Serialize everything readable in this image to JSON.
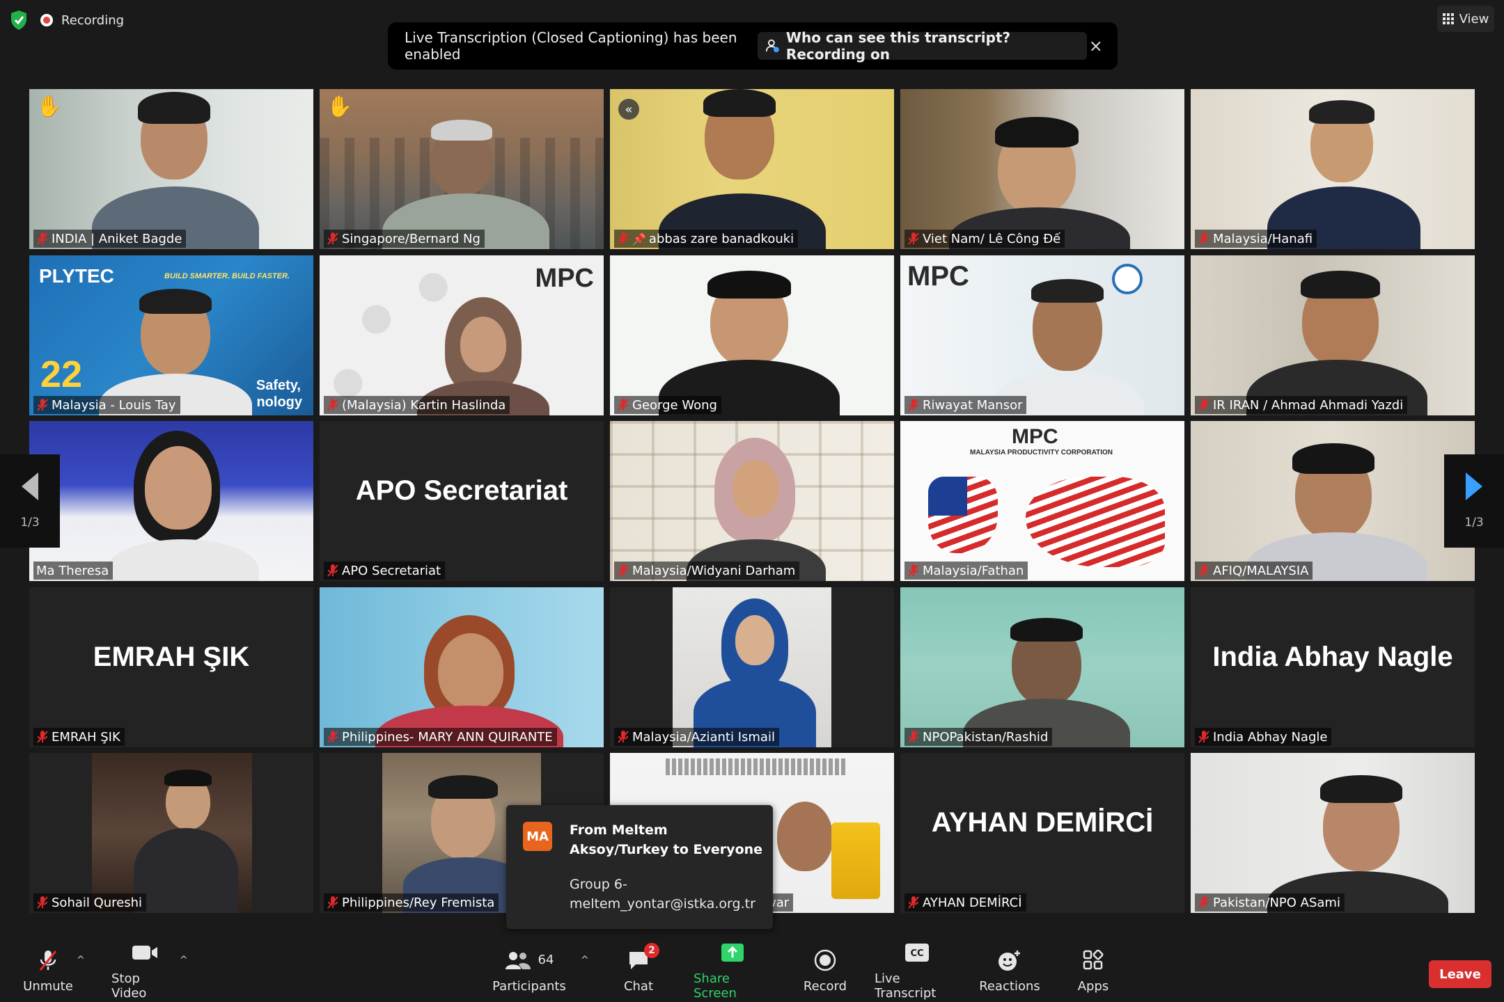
{
  "top": {
    "recording_label": "Recording",
    "view_label": "View"
  },
  "banner": {
    "text": "Live Transcription (Closed Captioning) has been enabled",
    "who_label": "Who can see this transcript? Recording on",
    "close": "×"
  },
  "participants": [
    {
      "name": "INDIA | Aniket Bagde"
    },
    {
      "name": "Singapore/Bernard Ng"
    },
    {
      "name": "abbas zare banadkouki"
    },
    {
      "name": "Viet Nam/ Lê Công Đế"
    },
    {
      "name": "Malaysia/Hanafi"
    },
    {
      "name": "Malaysia - Louis Tay"
    },
    {
      "name": "(Malaysia) Kartin Haslinda"
    },
    {
      "name": "George Wong"
    },
    {
      "name": "Riwayat Mansor"
    },
    {
      "name": "IR IRAN / Ahmad Ahmadi Yazdi"
    },
    {
      "name": "Ma Theresa"
    },
    {
      "name": "APO Secretariat"
    },
    {
      "name": "Malaysia/Widyani Darham"
    },
    {
      "name": "Malaysia/Fathan"
    },
    {
      "name": "AFIQ/MALAYSIA"
    },
    {
      "name": "EMRAH ŞIK"
    },
    {
      "name": "Philippines- MARY ANN QUIRANTE"
    },
    {
      "name": "Malaysia/Azianti Ismail"
    },
    {
      "name": "NPOPakistan/Rashid"
    },
    {
      "name": "India Abhay Nagle"
    },
    {
      "name": "Sohail Qureshi"
    },
    {
      "name": "Philippines/Rey Fremista"
    },
    {
      "name": "war"
    },
    {
      "name": "AYHAN DEMİRCİ"
    },
    {
      "name": "Pakistan/NPO ASami"
    }
  ],
  "tile_text": {
    "plytec": "PLYTEC",
    "build": "BUILD SMARTER. BUILD FASTER.",
    "safety": "Safety,",
    "nology": "nology",
    "mpc": "MPC",
    "mpc_corp": "MALAYSIA PRODUCTIVITY CORPORATION",
    "twentytwo": "22"
  },
  "page_indicator": "1/3",
  "chat_popup": {
    "avatar": "MA",
    "from": "From Meltem Aksoy/Turkey to Everyone",
    "line1": "Group 6-",
    "line2": "meltem_yontar@istka.org.tr"
  },
  "toolbar": {
    "unmute": "Unmute",
    "stop_video": "Stop Video",
    "participants": "Participants",
    "participants_count": "64",
    "chat": "Chat",
    "chat_badge": "2",
    "share_screen": "Share Screen",
    "record": "Record",
    "live_transcript": "Live Transcript",
    "reactions": "Reactions",
    "apps": "Apps",
    "leave": "Leave"
  },
  "colors": {
    "accent_blue": "#3aa0ff",
    "share_green": "#2fd46b",
    "leave_red": "#d92f2f",
    "active_outline": "#e7e77a",
    "chat_avatar": "#e8651d"
  }
}
